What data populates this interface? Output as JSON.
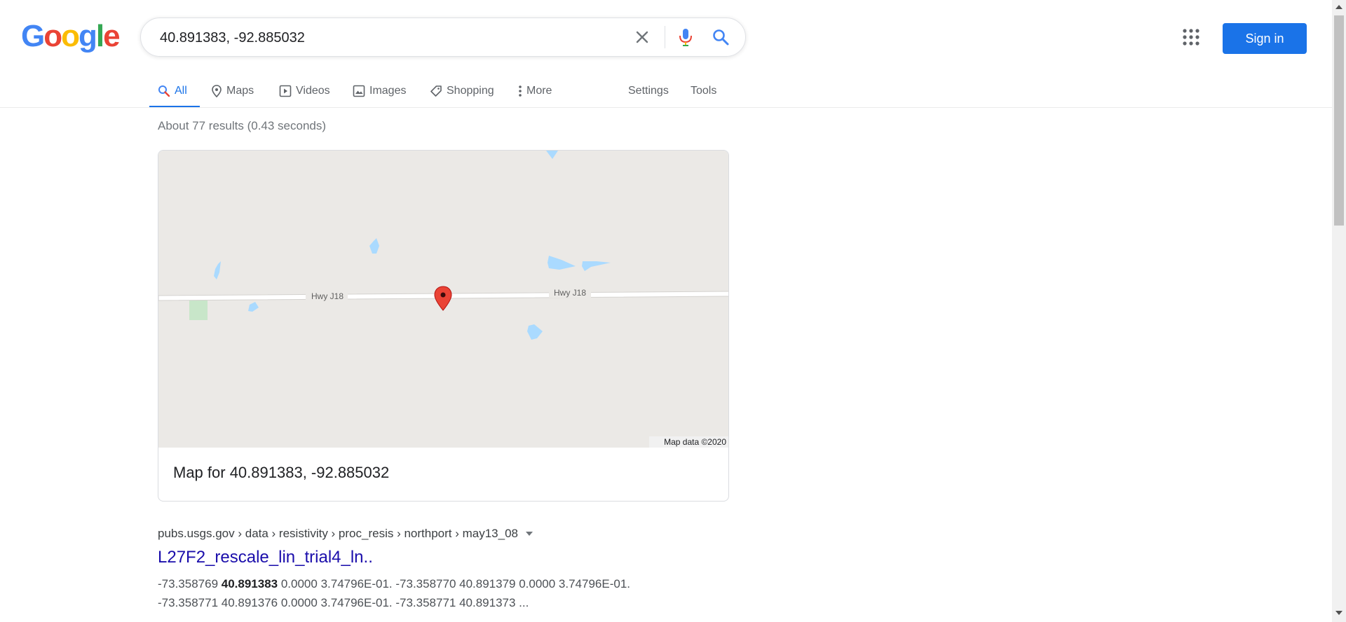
{
  "logo": {
    "letters": [
      "G",
      "o",
      "o",
      "g",
      "l",
      "e"
    ]
  },
  "search": {
    "query": "40.891383, -92.885032"
  },
  "header": {
    "sign_in": "Sign in"
  },
  "tabs": [
    {
      "label": "All",
      "icon": "search-icon"
    },
    {
      "label": "Maps",
      "icon": "map-pin-icon"
    },
    {
      "label": "Videos",
      "icon": "play-icon"
    },
    {
      "label": "Images",
      "icon": "image-icon"
    },
    {
      "label": "Shopping",
      "icon": "tag-icon"
    },
    {
      "label": "More",
      "icon": "more-vert-icon"
    },
    {
      "label": "Settings"
    },
    {
      "label": "Tools"
    }
  ],
  "results": {
    "stats": "About 77 results (0.43 seconds)"
  },
  "map": {
    "road_label_left": "Hwy J18",
    "road_label_right": "Hwy J18",
    "attribution": "Map data ©2020",
    "caption": "Map for 40.891383, -92.885032"
  },
  "result1": {
    "cite": "pubs.usgs.gov › data › resistivity › proc_resis › northport › may13_08",
    "title": "L27F2_rescale_lin_trial4_ln..",
    "snippet_1a": "-73.358769 ",
    "snippet_1b": "40.891383",
    "snippet_1c": " 0.0000 3.74796E-01. -73.358770 40.891379 0.0000 3.74796E-01.",
    "snippet_2": "-73.358771 40.891376 0.0000 3.74796E-01. -73.358771 40.891373 ..."
  },
  "colors": {
    "accent": "#1a73e8",
    "link": "#1a0dab",
    "water": "#aadaff",
    "park": "#c8e6c9",
    "pin": "#ea4335"
  }
}
